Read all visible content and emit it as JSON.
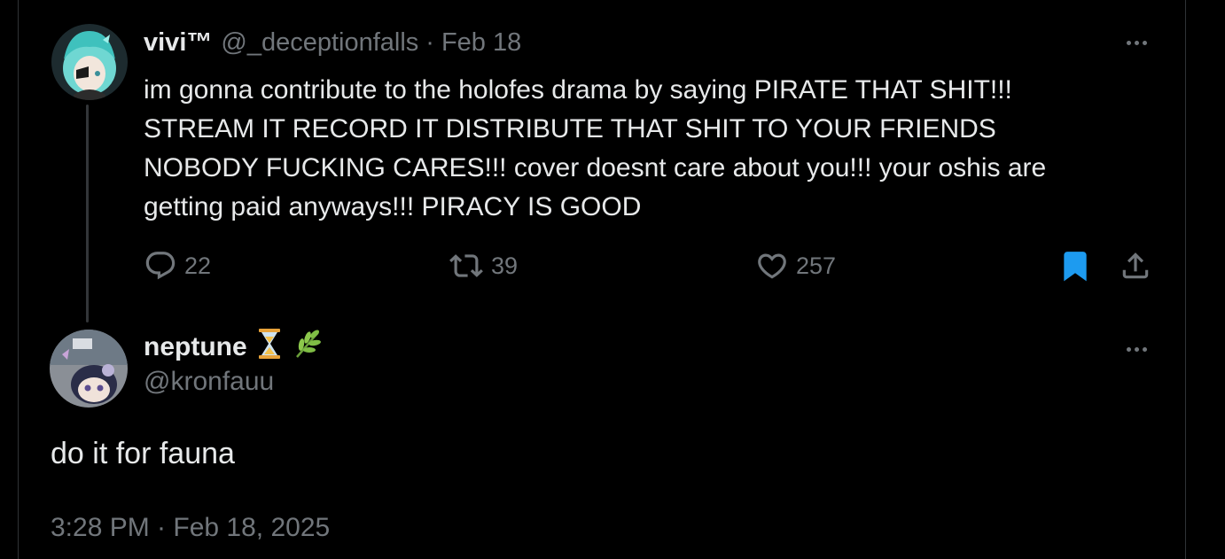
{
  "colors": {
    "background": "#000000",
    "text_primary": "#e7e9ea",
    "text_muted": "#71767b",
    "bookmark_active": "#1d9bf0",
    "divider": "#2f3336"
  },
  "parent_tweet": {
    "display_name": "vivi™",
    "handle": "@_deceptionfalls",
    "separator": "·",
    "date": "Feb 18",
    "text_lines": [
      "im gonna contribute to the holofes drama by saying PIRATE THAT SHIT!!!",
      "STREAM IT RECORD IT DISTRIBUTE THAT SHIT TO YOUR FRIENDS",
      "NOBODY FUCKING CARES!!! cover doesnt care about you!!! your oshis are",
      "getting paid anyways!!! PIRACY IS GOOD"
    ],
    "reply_count": "22",
    "retweet_count": "39",
    "like_count": "257",
    "icons": [
      "more-icon",
      "reply-icon",
      "retweet-icon",
      "like-icon",
      "bookmark-icon",
      "share-icon"
    ]
  },
  "reply_tweet": {
    "display_name": "neptune",
    "name_emojis": [
      "hourglass-emoji",
      "herb-emoji"
    ],
    "handle": "@kronfauu",
    "text": "do it for fauna",
    "timestamp": "3:28 PM · Feb 18, 2025",
    "icons": [
      "more-icon"
    ]
  }
}
